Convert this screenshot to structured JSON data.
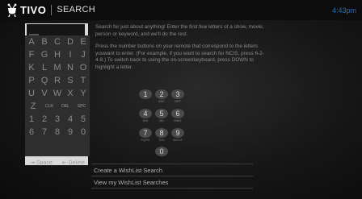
{
  "header": {
    "brand": "TIVO",
    "section": "SEARCH",
    "clock": "4:43pm"
  },
  "keyboard": {
    "rows": [
      [
        "A",
        "B",
        "C",
        "D",
        "E"
      ],
      [
        "F",
        "G",
        "H",
        "I",
        "J"
      ],
      [
        "K",
        "L",
        "M",
        "N",
        "O"
      ],
      [
        "P",
        "Q",
        "R",
        "S",
        "T"
      ],
      [
        "U",
        "V",
        "W",
        "X",
        "Y"
      ],
      [
        "Z",
        "CLR",
        "DEL",
        "SPC"
      ],
      [
        "1",
        "2",
        "3",
        "4",
        "5"
      ],
      [
        "6",
        "7",
        "8",
        "9",
        "0"
      ]
    ],
    "space_hint": "⇥ Space",
    "delete_hint": "⇤ Delete"
  },
  "instructions": {
    "paragraph1": "Search for just about anything! Enter the first few letters of a show, movie, person or keyword, and we'll do the rest.",
    "paragraph2": "Press the number buttons on your remote that correspond to the letters youwant to enter. (For example, if you want to search for NCIS, press 6-2-4-8.) To switch back to using the on-screenkeyboard, press DOWN to highlight a letter."
  },
  "keypad": [
    {
      "num": "1",
      "letters": ""
    },
    {
      "num": "2",
      "letters": "ABC"
    },
    {
      "num": "3",
      "letters": "DEF"
    },
    {
      "num": "4",
      "letters": "GHI"
    },
    {
      "num": "5",
      "letters": "JKL"
    },
    {
      "num": "6",
      "letters": "MNO"
    },
    {
      "num": "7",
      "letters": "PQRS"
    },
    {
      "num": "8",
      "letters": "TUV"
    },
    {
      "num": "9",
      "letters": "WXYZ"
    },
    {
      "num": "0",
      "letters": ""
    }
  ],
  "menu": {
    "item1": "Create a WishList Search",
    "item2": "View my WishList Searches"
  },
  "colors": {
    "clock": "#2a6fb0",
    "keyboard_bg": "#2e2e2e",
    "entry_frame": "#d9d9d9"
  },
  "icons": {
    "logo": "tivo-tv-icon",
    "space": "arrow-right-icon",
    "delete": "arrow-left-icon"
  }
}
